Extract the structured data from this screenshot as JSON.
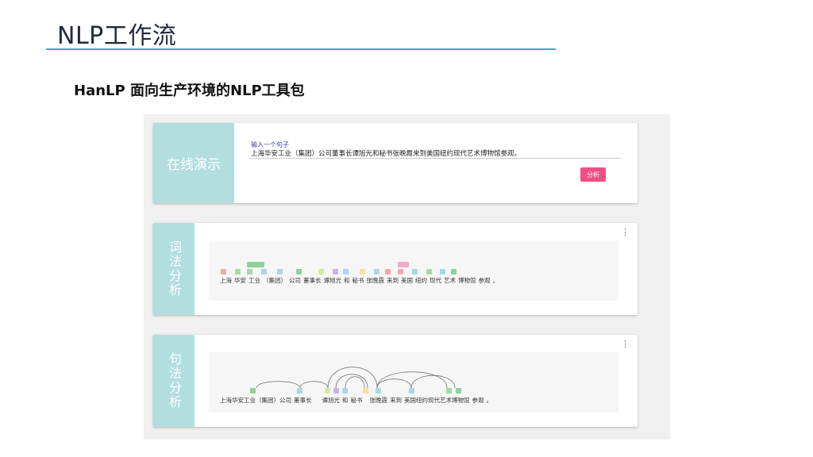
{
  "slide": {
    "title": "NLP工作流",
    "subtitle": "HanLP 面向生产环境的NLP工具包"
  },
  "demo": {
    "section_label": "在线演示",
    "input_label": "输入一个句子",
    "input_value": "上海华安工业（集团）公司董事长谭旭光和秘书张晚霞来到美国纽约现代艺术博物馆参观。",
    "analyze_button": "分析"
  },
  "lexical": {
    "section_label": "词法分析",
    "menu_icon": "more-vert-icon",
    "tokens": [
      "上海",
      "华安",
      "工业",
      "（集团）",
      "公司",
      "董事长",
      "谭旭光",
      "和",
      "秘书",
      "张晚霞",
      "来到",
      "美国",
      "纽约",
      "现代",
      "艺术",
      "博物馆",
      "参观",
      "。"
    ]
  },
  "syntax": {
    "section_label": "句法分析",
    "menu_icon": "more-vert-icon",
    "tokens": [
      "上海华安工业（集团）公司",
      "董事长",
      "谭旭光",
      "和",
      "秘书",
      "张晚霞",
      "来到",
      "美国纽约现代艺术博物馆",
      "参观",
      "。"
    ]
  },
  "colors": {
    "accent_rule": "#3fa9c5",
    "card_side": "#b2dede",
    "button": "#ef4f86"
  }
}
